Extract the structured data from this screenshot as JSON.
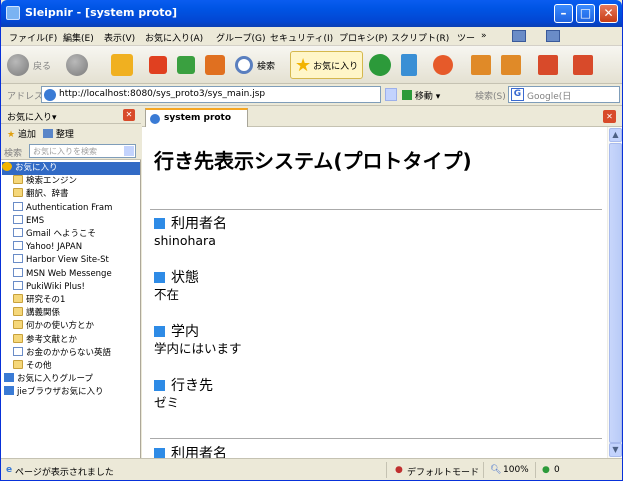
{
  "window": {
    "title": "Sleipnir - [system proto]"
  },
  "menu": [
    "ファイル(F)",
    "編集(E)",
    "表示(V)",
    "お気に入り(A)",
    "グループ(G)",
    "セキュリティ(I)",
    "プロキシ(P)",
    "スクリプト(R)",
    "ツー"
  ],
  "toolbar": {
    "back_label": "戻る",
    "search_label": "検索",
    "favorites_label": "お気に入り"
  },
  "address": {
    "label": "アドレス(D)",
    "url": "http://localhost:8080/sys_proto3/sys_main.jsp",
    "go_label": "移動",
    "search_label": "検索(S)",
    "search_engine": "Google(日"
  },
  "sidebar": {
    "title": "お気に入り▾",
    "add_label": "追加",
    "organize_label": "整理",
    "search_label": "検索",
    "search_placeholder": "お気に入りを検索",
    "items": [
      {
        "label": "お気に入り",
        "type": "root"
      },
      {
        "label": "検索エンジン",
        "type": "folder"
      },
      {
        "label": "翻訳、辞書",
        "type": "folder"
      },
      {
        "label": "Authentication Fram",
        "type": "page"
      },
      {
        "label": "EMS",
        "type": "page"
      },
      {
        "label": "Gmail へようこそ",
        "type": "page"
      },
      {
        "label": "Yahoo! JAPAN",
        "type": "page"
      },
      {
        "label": "Harbor View Site-St",
        "type": "page"
      },
      {
        "label": "MSN Web Messenge",
        "type": "page"
      },
      {
        "label": "PukiWiki Plus!",
        "type": "page"
      },
      {
        "label": "研究その1",
        "type": "folder"
      },
      {
        "label": "講義関係",
        "type": "folder"
      },
      {
        "label": "何かの使い方とか",
        "type": "folder"
      },
      {
        "label": "参考文献とか",
        "type": "folder"
      },
      {
        "label": "お金のかからない英語",
        "type": "page"
      },
      {
        "label": "その他",
        "type": "folder"
      },
      {
        "label": "お気に入りグループ",
        "type": "group"
      },
      {
        "label": "jieブラウザお気に入り",
        "type": "group"
      }
    ]
  },
  "tab": {
    "label": "system proto"
  },
  "page": {
    "heading": "行き先表示システム(プロトタイプ)",
    "sections": [
      {
        "label": "利用者名",
        "value": "shinohara"
      },
      {
        "label": "状態",
        "value": "不在"
      },
      {
        "label": "学内",
        "value": "学内にはいます"
      },
      {
        "label": "行き先",
        "value": "ゼミ"
      },
      {
        "label": "利用者名",
        "value": ""
      }
    ]
  },
  "status": {
    "message": "ページが表示されました",
    "mode": "デフォルトモード",
    "zoom": "100%",
    "popup_count": "0"
  },
  "colors": {
    "title_bar": "#0055e5",
    "section_bullet": "#2e8be6",
    "tab_accent": "#f5a623"
  }
}
